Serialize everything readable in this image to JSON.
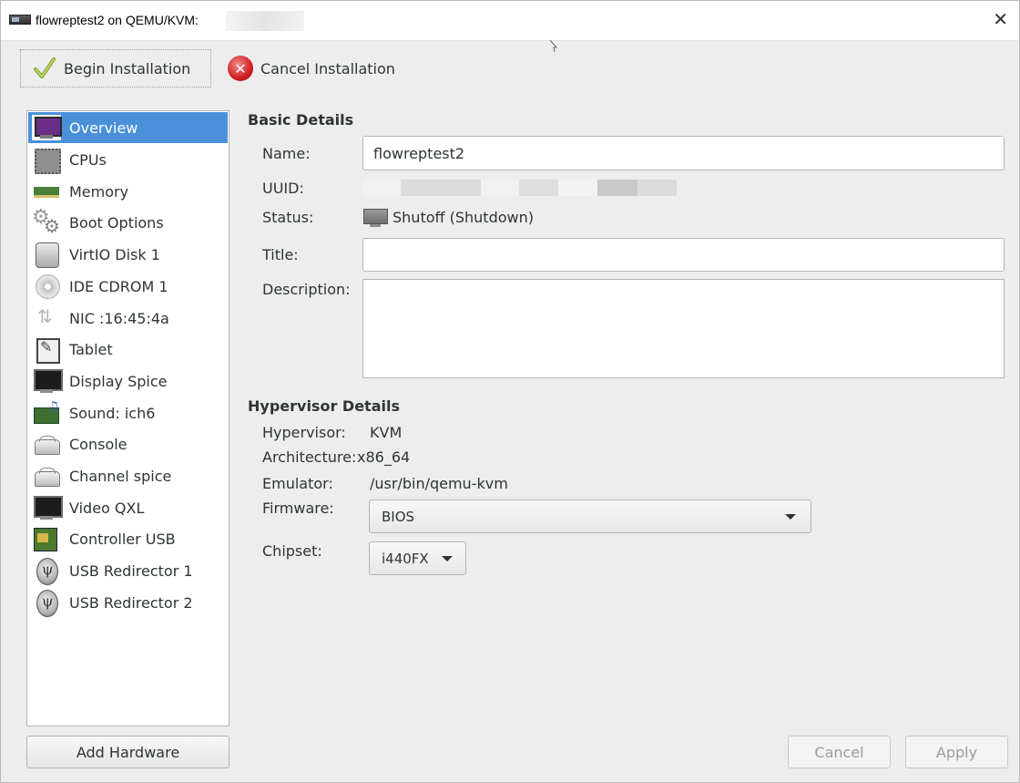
{
  "window": {
    "title": "flowreptest2 on QEMU/KVM:",
    "close_glyph": "✕"
  },
  "toolbar": {
    "begin_label": "Begin Installation",
    "cancel_label": "Cancel Installation",
    "cancel_glyph": "✕"
  },
  "sidebar": {
    "items": [
      {
        "label": "Overview",
        "icon": "monitor-icon"
      },
      {
        "label": "CPUs",
        "icon": "cpu-chip-icon"
      },
      {
        "label": "Memory",
        "icon": "memory-module-icon"
      },
      {
        "label": "Boot Options",
        "icon": "gears-icon"
      },
      {
        "label": "VirtIO Disk 1",
        "icon": "hard-disk-icon"
      },
      {
        "label": "IDE CDROM 1",
        "icon": "cdrom-icon"
      },
      {
        "label": "NIC :16:45:4a",
        "icon": "network-icon"
      },
      {
        "label": "Tablet",
        "icon": "tablet-icon"
      },
      {
        "label": "Display Spice",
        "icon": "display-icon"
      },
      {
        "label": "Sound: ich6",
        "icon": "sound-card-icon"
      },
      {
        "label": "Console",
        "icon": "serial-console-icon"
      },
      {
        "label": "Channel spice",
        "icon": "channel-icon"
      },
      {
        "label": "Video QXL",
        "icon": "video-icon"
      },
      {
        "label": "Controller USB",
        "icon": "usb-controller-icon"
      },
      {
        "label": "USB Redirector 1",
        "icon": "usb-icon"
      },
      {
        "label": "USB Redirector 2",
        "icon": "usb-icon"
      }
    ],
    "selected_index": 0,
    "add_hardware_label": "Add Hardware"
  },
  "basic": {
    "title": "Basic Details",
    "name_label": "Name:",
    "name_value": "flowreptest2",
    "uuid_label": "UUID:",
    "status_label": "Status:",
    "status_value": "Shutoff (Shutdown)",
    "title_label": "Title:",
    "title_value": "",
    "description_label": "Description:",
    "description_value": ""
  },
  "hypervisor": {
    "title": "Hypervisor Details",
    "hypervisor_label": "Hypervisor:",
    "hypervisor_value": "KVM",
    "arch_label": "Architecture:",
    "arch_value": "x86_64",
    "emulator_label": "Emulator:",
    "emulator_value": "/usr/bin/qemu-kvm",
    "firmware_label": "Firmware:",
    "firmware_value": "BIOS",
    "chipset_label": "Chipset:",
    "chipset_value": "i440FX"
  },
  "footer": {
    "cancel_label": "Cancel",
    "apply_label": "Apply"
  },
  "colors": {
    "selection": "#4a90d9",
    "background": "#ededed"
  }
}
